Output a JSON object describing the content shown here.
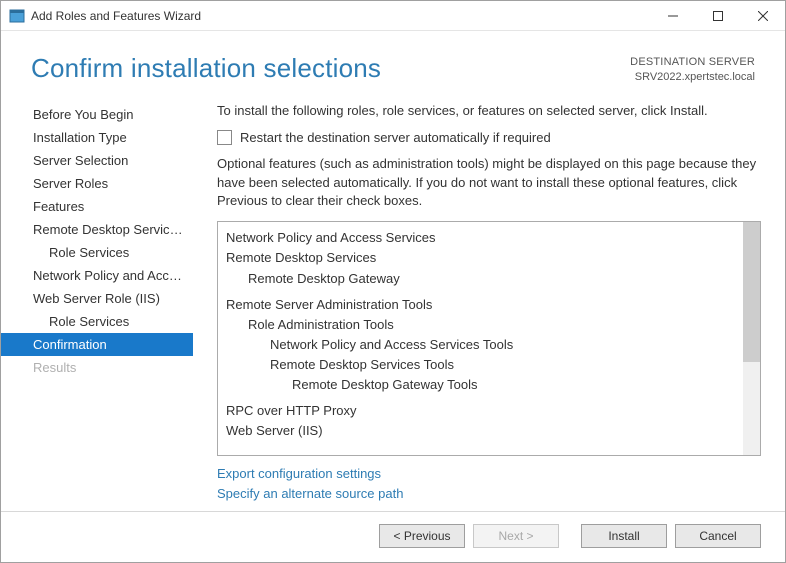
{
  "window": {
    "title": "Add Roles and Features Wizard"
  },
  "header": {
    "title": "Confirm installation selections",
    "dest_label": "DESTINATION SERVER",
    "dest_value": "SRV2022.xpertstec.local"
  },
  "sidebar": {
    "items": [
      {
        "label": "Before You Begin",
        "sub": false,
        "selected": false,
        "disabled": false
      },
      {
        "label": "Installation Type",
        "sub": false,
        "selected": false,
        "disabled": false
      },
      {
        "label": "Server Selection",
        "sub": false,
        "selected": false,
        "disabled": false
      },
      {
        "label": "Server Roles",
        "sub": false,
        "selected": false,
        "disabled": false
      },
      {
        "label": "Features",
        "sub": false,
        "selected": false,
        "disabled": false
      },
      {
        "label": "Remote Desktop Services",
        "sub": false,
        "selected": false,
        "disabled": false
      },
      {
        "label": "Role Services",
        "sub": true,
        "selected": false,
        "disabled": false
      },
      {
        "label": "Network Policy and Acces...",
        "sub": false,
        "selected": false,
        "disabled": false
      },
      {
        "label": "Web Server Role (IIS)",
        "sub": false,
        "selected": false,
        "disabled": false
      },
      {
        "label": "Role Services",
        "sub": true,
        "selected": false,
        "disabled": false
      },
      {
        "label": "Confirmation",
        "sub": false,
        "selected": true,
        "disabled": false
      },
      {
        "label": "Results",
        "sub": false,
        "selected": false,
        "disabled": true
      }
    ]
  },
  "main": {
    "intro": "To install the following roles, role services, or features on selected server, click Install.",
    "restart_label": "Restart the destination server automatically if required",
    "note": "Optional features (such as administration tools) might be displayed on this page because they have been selected automatically. If you do not want to install these optional features, click Previous to clear their check boxes.",
    "list": [
      {
        "text": "Network Policy and Access Services",
        "indent": 0,
        "top": false
      },
      {
        "text": "Remote Desktop Services",
        "indent": 0,
        "top": false
      },
      {
        "text": "Remote Desktop Gateway",
        "indent": 1,
        "top": false
      },
      {
        "text": "Remote Server Administration Tools",
        "indent": 0,
        "top": true
      },
      {
        "text": "Role Administration Tools",
        "indent": 1,
        "top": false
      },
      {
        "text": "Network Policy and Access Services Tools",
        "indent": 2,
        "top": false
      },
      {
        "text": "Remote Desktop Services Tools",
        "indent": 2,
        "top": false
      },
      {
        "text": "Remote Desktop Gateway Tools",
        "indent": 3,
        "top": false
      },
      {
        "text": "RPC over HTTP Proxy",
        "indent": 0,
        "top": true
      },
      {
        "text": "Web Server (IIS)",
        "indent": 0,
        "top": false
      }
    ],
    "link_export": "Export configuration settings",
    "link_alt": "Specify an alternate source path"
  },
  "footer": {
    "previous": "< Previous",
    "next": "Next >",
    "install": "Install",
    "cancel": "Cancel"
  }
}
